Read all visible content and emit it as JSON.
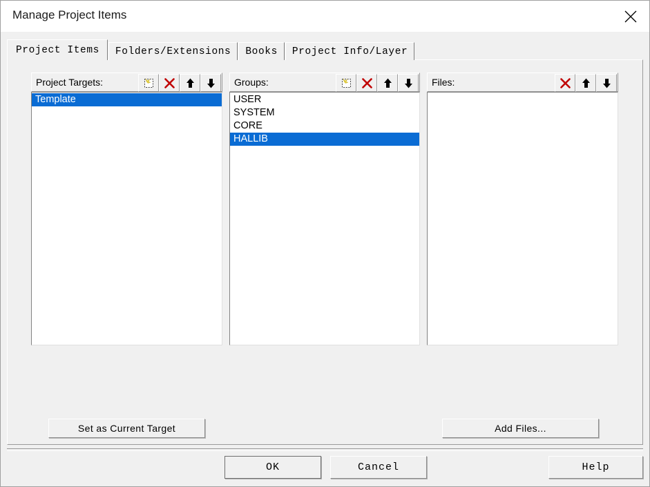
{
  "window": {
    "title": "Manage Project Items",
    "close_icon": "close-icon"
  },
  "tabs": [
    {
      "label": "Project Items",
      "selected": true
    },
    {
      "label": "Folders/Extensions",
      "selected": false
    },
    {
      "label": "Books",
      "selected": false
    },
    {
      "label": "Project Info/Layer",
      "selected": false
    }
  ],
  "columns": {
    "targets": {
      "label": "Project Targets:",
      "tools": [
        "new-item-icon",
        "delete-icon",
        "move-up-icon",
        "move-down-icon"
      ],
      "items": [
        {
          "label": "Template",
          "selected": true
        }
      ]
    },
    "groups": {
      "label": "Groups:",
      "tools": [
        "new-item-icon",
        "delete-icon",
        "move-up-icon",
        "move-down-icon"
      ],
      "items": [
        {
          "label": "USER",
          "selected": false
        },
        {
          "label": "SYSTEM",
          "selected": false
        },
        {
          "label": "CORE",
          "selected": false
        },
        {
          "label": "HALLIB",
          "selected": true
        }
      ]
    },
    "files": {
      "label": "Files:",
      "tools": [
        "delete-icon",
        "move-up-icon",
        "move-down-icon"
      ],
      "items": []
    }
  },
  "actions": {
    "set_as_current_target": "Set as Current Target",
    "add_files": "Add Files..."
  },
  "dialog_buttons": {
    "ok": "OK",
    "cancel": "Cancel",
    "help": "Help"
  },
  "colors": {
    "selection": "#0a6cd4",
    "selection_text": "#ffffff",
    "dialog_face": "#f0f0f0",
    "titlebar": "#ffffff",
    "delete_icon": "#c00000"
  }
}
